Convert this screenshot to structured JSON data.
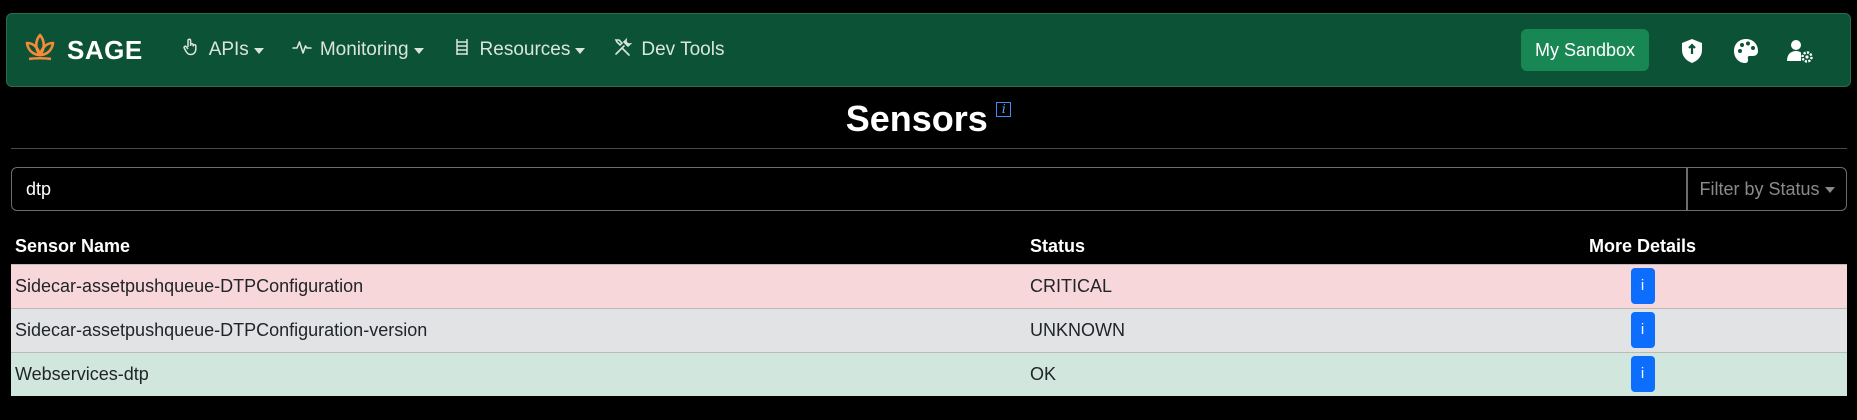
{
  "navbar": {
    "brand": "SAGE",
    "items": [
      {
        "label": "APIs",
        "icon": "hand-pointer-icon",
        "dropdown": true
      },
      {
        "label": "Monitoring",
        "icon": "pulse-icon",
        "dropdown": true
      },
      {
        "label": "Resources",
        "icon": "ladder-icon",
        "dropdown": true
      },
      {
        "label": "Dev Tools",
        "icon": "tools-icon",
        "dropdown": false
      }
    ],
    "sandbox_label": "My Sandbox",
    "right_icons": [
      "shield-icon",
      "palette-icon",
      "user-gear-icon"
    ],
    "brand_color": "#0c5236",
    "accent_color": "#198754"
  },
  "page": {
    "title": "Sensors",
    "info_badge": "i"
  },
  "search": {
    "value": "dtp",
    "filter_label": "Filter by Status"
  },
  "table": {
    "headers": [
      "Sensor Name",
      "Status",
      "More Details"
    ],
    "rows": [
      {
        "name": "Sidecar-assetpushqueue-DTPConfiguration",
        "status": "CRITICAL",
        "details": "i"
      },
      {
        "name": "Sidecar-assetpushqueue-DTPConfiguration-version",
        "status": "UNKNOWN",
        "details": "i"
      },
      {
        "name": "Webservices-dtp",
        "status": "OK",
        "details": "i"
      }
    ],
    "status_colors": {
      "CRITICAL": "#f8d7da",
      "UNKNOWN": "#e2e3e5",
      "OK": "#d1e7dd"
    }
  }
}
